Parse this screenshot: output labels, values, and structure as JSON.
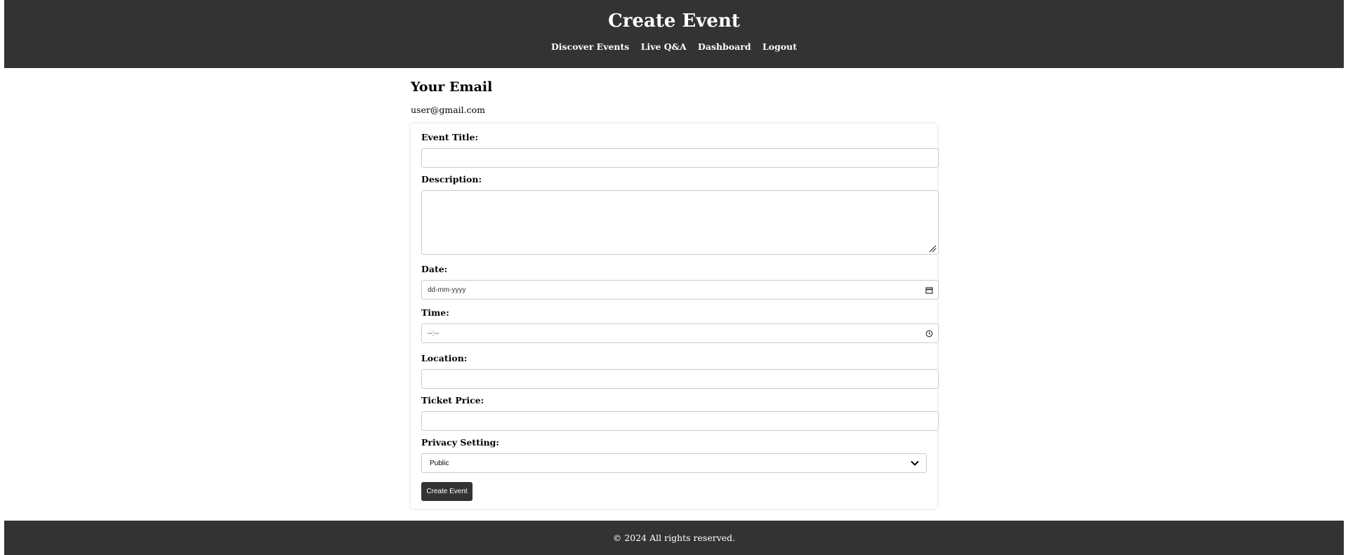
{
  "header": {
    "title": "Create Event",
    "nav": [
      {
        "label": "Discover Events"
      },
      {
        "label": "Live Q&A"
      },
      {
        "label": "Dashboard"
      },
      {
        "label": "Logout"
      }
    ]
  },
  "account": {
    "heading": "Your Email",
    "email": "user@gmail.com"
  },
  "form": {
    "title_label": "Event Title:",
    "title_value": "",
    "description_label": "Description:",
    "description_value": "",
    "date_label": "Date:",
    "date_placeholder": "dd-mm-yyyy",
    "time_label": "Time:",
    "time_placeholder": "--:--",
    "location_label": "Location:",
    "location_value": "",
    "price_label": "Ticket Price:",
    "price_value": "",
    "privacy_label": "Privacy Setting:",
    "privacy_selected": "Public",
    "submit_label": "Create Event",
    "icons": {
      "date": "calendar-icon",
      "time": "clock-icon",
      "select": "chevron-down-icon",
      "resize": "resize-handle-icon"
    }
  },
  "footer": {
    "copyright": "© 2024 All rights reserved."
  },
  "colors": {
    "header_bg": "#333333",
    "footer_bg": "#333333",
    "button_bg": "#333333",
    "border": "#cccccc"
  }
}
